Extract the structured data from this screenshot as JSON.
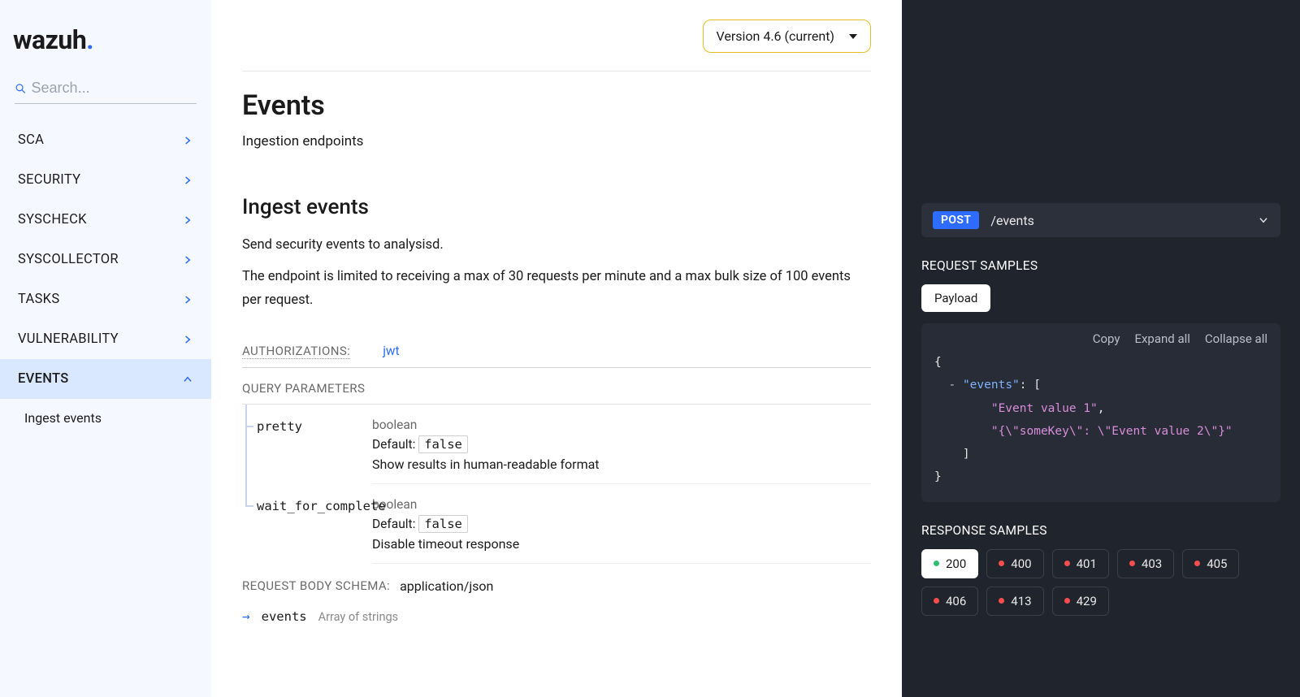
{
  "logo": {
    "name": "wazuh"
  },
  "search": {
    "placeholder": "Search..."
  },
  "nav": {
    "items": [
      {
        "label": "SCA",
        "expanded": false
      },
      {
        "label": "SECURITY",
        "expanded": false
      },
      {
        "label": "SYSCHECK",
        "expanded": false
      },
      {
        "label": "SYSCOLLECTOR",
        "expanded": false
      },
      {
        "label": "TASKS",
        "expanded": false
      },
      {
        "label": "VULNERABILITY",
        "expanded": false
      },
      {
        "label": "EVENTS",
        "expanded": true
      }
    ],
    "sub": {
      "label": "Ingest events"
    }
  },
  "version_selector": "Version 4.6 (current)",
  "page": {
    "title": "Events",
    "subtitle": "Ingestion endpoints",
    "section_title": "Ingest events",
    "desc1": "Send security events to analysisd.",
    "desc2": "The endpoint is limited to receiving a max of 30 requests per minute and a max bulk size of 100 events per request.",
    "auth_label": "AUTHORIZATIONS:",
    "auth_value": "jwt",
    "qp_label": "QUERY PARAMETERS",
    "params": [
      {
        "name": "pretty",
        "type": "boolean",
        "default_label": "Default:",
        "default": "false",
        "desc": "Show results in human-readable format"
      },
      {
        "name": "wait_for_complete",
        "type": "boolean",
        "default_label": "Default:",
        "default": "false",
        "desc": "Disable timeout response"
      }
    ],
    "rb_label": "REQUEST BODY SCHEMA:",
    "rb_value": "application/json",
    "body_param": {
      "name": "events",
      "type": "Array of strings"
    }
  },
  "right": {
    "method": "POST",
    "path": "/events",
    "request_samples": "REQUEST SAMPLES",
    "payload_tab": "Payload",
    "code_actions": {
      "copy": "Copy",
      "expand": "Expand all",
      "collapse": "Collapse all"
    },
    "json_sample": {
      "key": "\"events\"",
      "val1": "\"Event value 1\"",
      "val2": "\"{\\\"someKey\\\": \\\"Event value 2\\\"}\""
    },
    "response_samples": "RESPONSE SAMPLES",
    "responses": [
      {
        "code": "200",
        "ok": true
      },
      {
        "code": "400",
        "ok": false
      },
      {
        "code": "401",
        "ok": false
      },
      {
        "code": "403",
        "ok": false
      },
      {
        "code": "405",
        "ok": false
      },
      {
        "code": "406",
        "ok": false
      },
      {
        "code": "413",
        "ok": false
      },
      {
        "code": "429",
        "ok": false
      }
    ]
  }
}
